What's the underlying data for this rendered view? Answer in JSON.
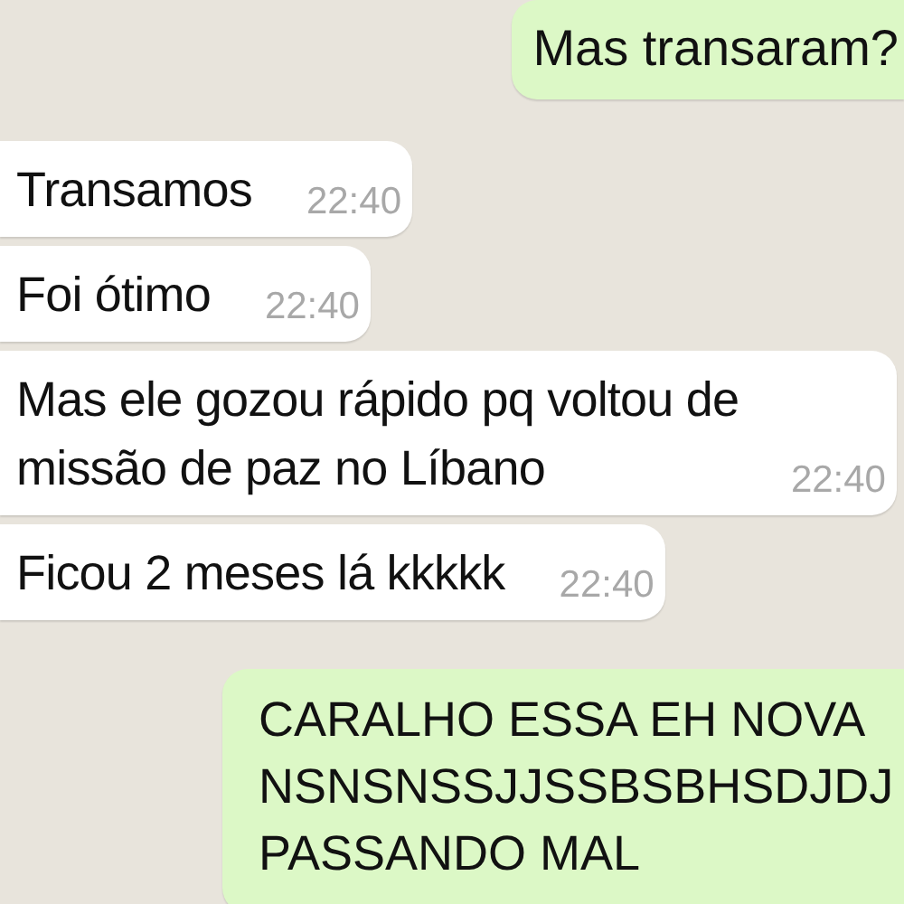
{
  "messages": [
    {
      "kind": "sent",
      "text": "Mas transaram?"
    },
    {
      "kind": "received",
      "text": "Transamos",
      "time": "22:40"
    },
    {
      "kind": "received",
      "text": "Foi ótimo",
      "time": "22:40"
    },
    {
      "kind": "received",
      "text": "Mas ele gozou rápido pq voltou de missão de paz no Líbano",
      "time": "22:40"
    },
    {
      "kind": "received",
      "text": "Ficou 2 meses lá kkkkk",
      "time": "22:40"
    },
    {
      "kind": "sent",
      "text": "CARALHO ESSA EH NOVA NSNSNSSJJSSBSBHSDJDJ PASSANDO MAL"
    }
  ]
}
